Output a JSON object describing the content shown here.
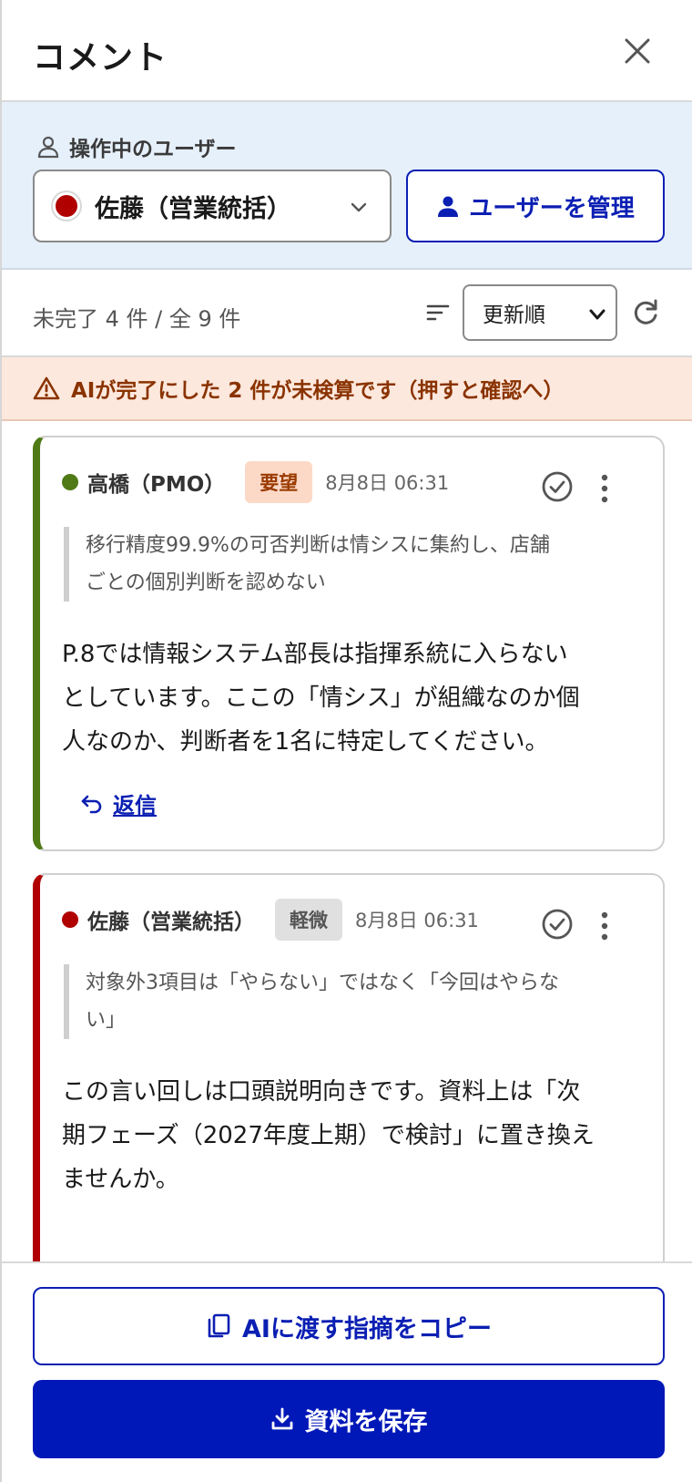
{
  "header": {
    "title": "コメント"
  },
  "user_bar": {
    "label": "操作中のユーザー",
    "selected_user": "佐藤（営業統括）",
    "selected_user_color": "#b00000",
    "manage_button": "ユーザーを管理"
  },
  "filter_bar": {
    "count_text": "未完了 4 件 / 全 9 件",
    "sort_value": "更新順"
  },
  "warning": {
    "text": "AIが完了にした 2 件が未検算です（押すと確認へ）"
  },
  "comments": [
    {
      "author": "高橋（PMO）",
      "author_color": "#4f7a16",
      "tag": "要望",
      "time": "8月8日 06:31",
      "quote_line1": "移行精度99.9%の可否判断は情シスに集約し、店舗",
      "quote_line2": "ごとの個別判断を認めない",
      "body_line1": "P.8では情報システム部長は指揮系統に入らない",
      "body_line2": "としています。ここの「情シス」が組織なのか個",
      "body_line3": "人なのか、判断者を1名に特定してください。",
      "reply": "返信"
    },
    {
      "author": "佐藤（営業統括）",
      "author_color": "#b00000",
      "tag": "軽微",
      "time": "8月8日 06:31",
      "quote_line1": "対象外3項目は「やらない」ではなく「今回はやらな",
      "quote_line2": "い」",
      "body_line1": "この言い回しは口頭説明向きです。資料上は「次",
      "body_line2": "期フェーズ（2027年度上期）で検討」に置き換え",
      "body_line3": "ませんか。"
    }
  ],
  "footer": {
    "copy_button": "AIに渡す指摘をコピー",
    "save_button": "資料を保存"
  },
  "colors": {
    "accent": "#0b1fb3",
    "primary_button": "#0018b8",
    "warning_bg": "#fde8dd",
    "user_bar_bg": "#e6f0fb"
  },
  "icons": [
    "close-icon",
    "person-outline-icon",
    "chevron-down-icon",
    "person-icon",
    "sort-icon",
    "refresh-icon",
    "warning-icon",
    "check-circle-icon",
    "more-vertical-icon",
    "reply-icon",
    "copy-icon",
    "download-icon"
  ]
}
